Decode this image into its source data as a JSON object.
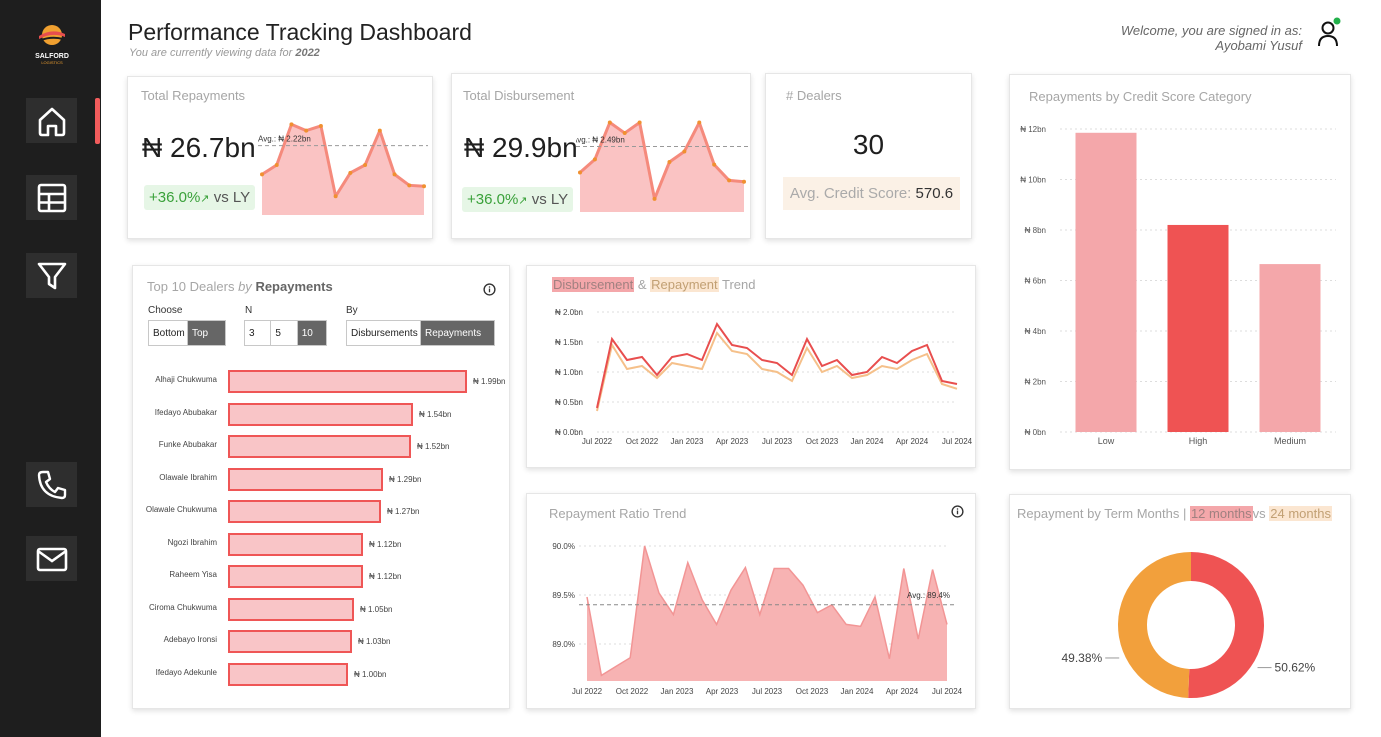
{
  "brand": {
    "name": "SALFORD",
    "sub": "LOGISTICS"
  },
  "header": {
    "title": "Performance Tracking Dashboard",
    "subtitle_prefix": "You are currently viewing data for",
    "year": "2022",
    "welcome": "Welcome, you are signed in as:",
    "user": "Ayobami Yusuf"
  },
  "nav": [
    "home-icon",
    "table-icon",
    "filter-icon",
    "phone-icon",
    "mail-icon"
  ],
  "kpi": {
    "repayments": {
      "title": "Total Repayments",
      "value": "₦ 26.7bn",
      "change": "+36.0%",
      "arrow": "↗",
      "vs": "vs LY",
      "avg": "Avg.: ₦ 2.22bn",
      "trend": [
        1.3,
        1.6,
        2.9,
        2.7,
        2.85,
        0.6,
        1.35,
        1.6,
        2.7,
        1.3,
        0.95,
        0.92
      ]
    },
    "disbursement": {
      "title": "Total Disbursement",
      "value": "₦ 29.9bn",
      "change": "+36.0%",
      "arrow": "↗",
      "vs": "vs LY",
      "avg": "Avg.: ₦ 2.49bn",
      "trend": [
        1.5,
        2.0,
        3.4,
        3.0,
        3.4,
        0.5,
        1.9,
        2.3,
        3.4,
        1.8,
        1.2,
        1.15
      ]
    },
    "dealers": {
      "title": "# Dealers",
      "value": "30",
      "credit_label": "Avg. Credit Score:",
      "credit_value": "570.6"
    }
  },
  "top_dealers": {
    "title_pre": "Top 10 Dealers",
    "title_by": "by",
    "title_metric": "Repayments",
    "choose": {
      "label": "Choose",
      "options": [
        "Bottom",
        "Top"
      ],
      "selected": "Top"
    },
    "n": {
      "label": "N",
      "options": [
        "3",
        "5",
        "10"
      ],
      "selected": "10"
    },
    "by": {
      "label": "By",
      "options": [
        "Disbursements",
        "Repayments"
      ],
      "selected": "Repayments"
    },
    "rows": [
      {
        "name": "Alhaji Chukwuma",
        "value": 1.99,
        "label": "₦ 1.99bn"
      },
      {
        "name": "Ifedayo Abubakar",
        "value": 1.54,
        "label": "₦ 1.54bn"
      },
      {
        "name": "Funke Abubakar",
        "value": 1.52,
        "label": "₦ 1.52bn"
      },
      {
        "name": "Olawale Ibrahim",
        "value": 1.29,
        "label": "₦ 1.29bn"
      },
      {
        "name": "Olawale Chukwuma",
        "value": 1.27,
        "label": "₦ 1.27bn"
      },
      {
        "name": "Ngozi Ibrahim",
        "value": 1.12,
        "label": "₦ 1.12bn"
      },
      {
        "name": "Raheem Yisa",
        "value": 1.12,
        "label": "₦ 1.12bn"
      },
      {
        "name": "Ciroma Chukwuma",
        "value": 1.05,
        "label": "₦ 1.05bn"
      },
      {
        "name": "Adebayo Ironsi",
        "value": 1.03,
        "label": "₦ 1.03bn"
      },
      {
        "name": "Ifedayo Adekunle",
        "value": 1.0,
        "label": "₦ 1.00bn"
      }
    ]
  },
  "trend_chart": {
    "title_a": "Disbursement",
    "title_amp": "&",
    "title_b": "Repayment",
    "title_c": "Trend",
    "yticks": [
      "₦ 0.0bn",
      "₦ 0.5bn",
      "₦ 1.0bn",
      "₦ 1.5bn",
      "₦ 2.0bn"
    ],
    "xticks": [
      "Jul 2022",
      "Oct 2022",
      "Jan 2023",
      "Apr 2023",
      "Jul 2023",
      "Oct 2023",
      "Jan 2024",
      "Apr 2024",
      "Jul 2024"
    ],
    "disbursement": [
      0.4,
      1.55,
      1.2,
      1.25,
      0.95,
      1.25,
      1.3,
      1.2,
      1.8,
      1.45,
      1.4,
      1.2,
      1.15,
      0.95,
      1.55,
      1.1,
      1.2,
      0.95,
      1.0,
      1.25,
      1.15,
      1.35,
      1.45,
      0.85,
      0.8
    ],
    "repayment": [
      0.35,
      1.45,
      1.05,
      1.1,
      0.9,
      1.15,
      1.1,
      1.05,
      1.65,
      1.35,
      1.3,
      1.05,
      1.0,
      0.85,
      1.4,
      1.0,
      1.1,
      0.9,
      0.95,
      1.1,
      1.05,
      1.2,
      1.3,
      0.8,
      0.72
    ],
    "colors": {
      "disbursement": "#e84e4e",
      "repayment": "#f5c08a"
    }
  },
  "ratio_chart": {
    "title": "Repayment Ratio Trend",
    "yticks": [
      "89.0%",
      "89.5%",
      "90.0%"
    ],
    "xticks": [
      "Jul 2022",
      "Oct 2022",
      "Jan 2023",
      "Apr 2023",
      "Jul 2023",
      "Oct 2023",
      "Jan 2024",
      "Apr 2024",
      "Jul 2024"
    ],
    "avg_label": "Avg.: 89.4%",
    "values": [
      89.48,
      88.68,
      88.77,
      88.86,
      90.0,
      89.52,
      89.3,
      89.83,
      89.45,
      89.2,
      89.55,
      89.78,
      89.3,
      89.77,
      89.77,
      89.6,
      89.32,
      89.4,
      89.2,
      89.18,
      89.48,
      88.85,
      89.77,
      89.05,
      89.76,
      89.2
    ]
  },
  "credit_chart": {
    "title": "Repayments by Credit Score Category",
    "yticks": [
      "₦ 0bn",
      "₦ 2bn",
      "₦ 4bn",
      "₦ 6bn",
      "₦ 8bn",
      "₦ 10bn",
      "₦ 12bn"
    ],
    "categories": [
      "Low",
      "High",
      "Medium"
    ],
    "values": [
      11.85,
      8.2,
      6.65
    ],
    "colors": [
      "#f4a7aa",
      "#ef5353",
      "#f4a7aa"
    ]
  },
  "term_chart": {
    "title_pre": "Repayment by Term Months |",
    "label_12": "12 months",
    "title_vs": "vs",
    "label_24": "24 months",
    "slices": [
      {
        "label": "50.62%",
        "value": 50.62,
        "color": "#ef5353"
      },
      {
        "label": "49.38%",
        "value": 49.38,
        "color": "#f2a03c"
      }
    ]
  }
}
